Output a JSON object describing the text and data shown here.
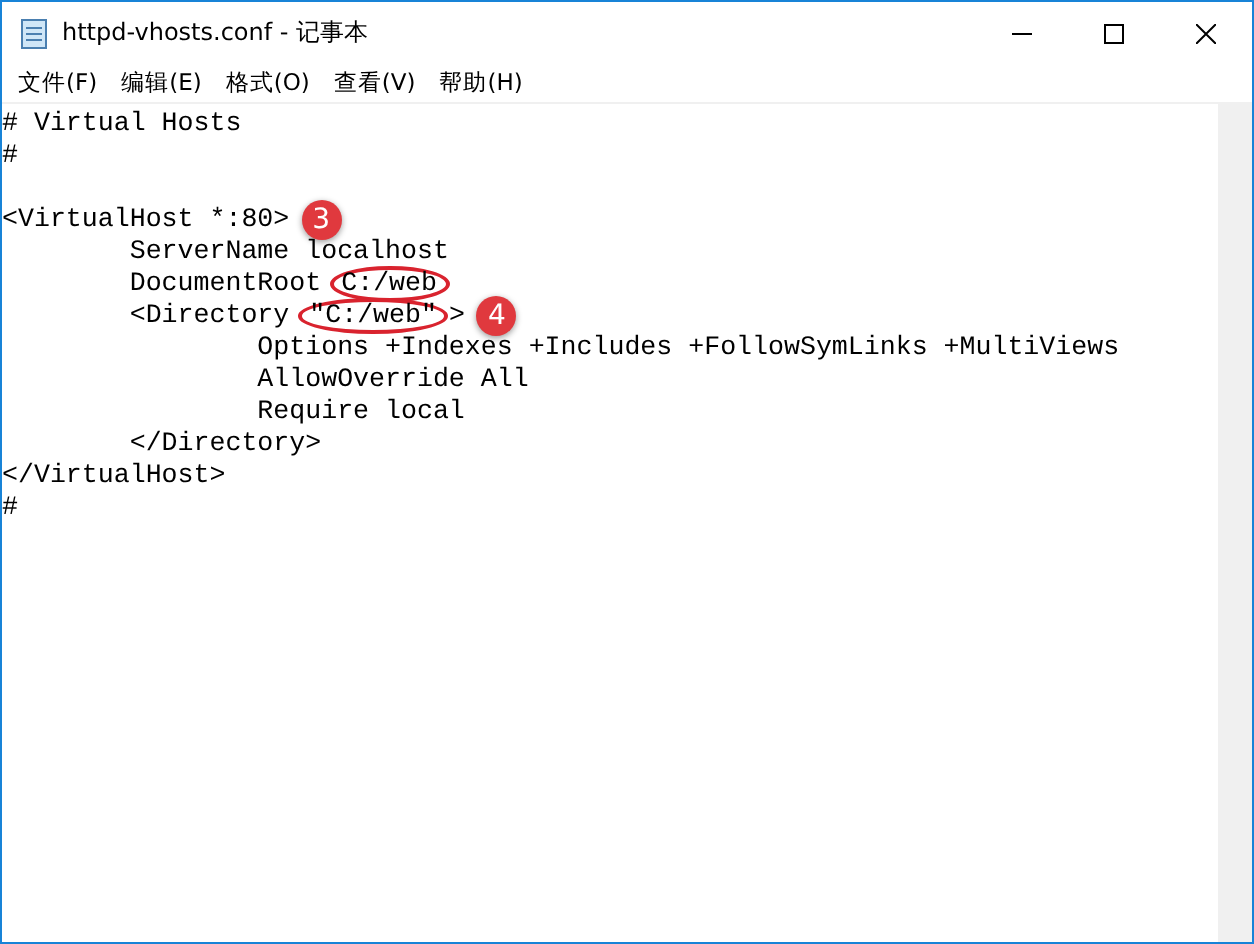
{
  "window": {
    "title": "httpd-vhosts.conf - 记事本"
  },
  "menu": [
    "文件(F)",
    "编辑(E)",
    "格式(O)",
    "查看(V)",
    "帮助(H)"
  ],
  "paragraphs": [
    {
      "lines": [
        {
          "text": "# Virtual Hosts"
        },
        {
          "text": "#"
        }
      ]
    },
    {
      "lines": [
        {
          "text": "<VirtualHost *:80>",
          "badge": "3"
        },
        {
          "text": "\tServerName localhost"
        },
        {
          "text": "\tDocumentRoot",
          "circled": "C:/web"
        },
        {
          "text": "\t<Directory",
          "circled": "\"C:/web\"",
          "after": ">",
          "badge": "4"
        },
        {
          "text": "\t\tOptions +Indexes +Includes +FollowSymLinks +MultiViews"
        },
        {
          "text": "\t\tAllowOverride All"
        },
        {
          "text": "\t\tRequire local"
        },
        {
          "text": "\t</Directory>"
        },
        {
          "text": "</VirtualHost>"
        },
        {
          "text": "#"
        }
      ]
    }
  ]
}
